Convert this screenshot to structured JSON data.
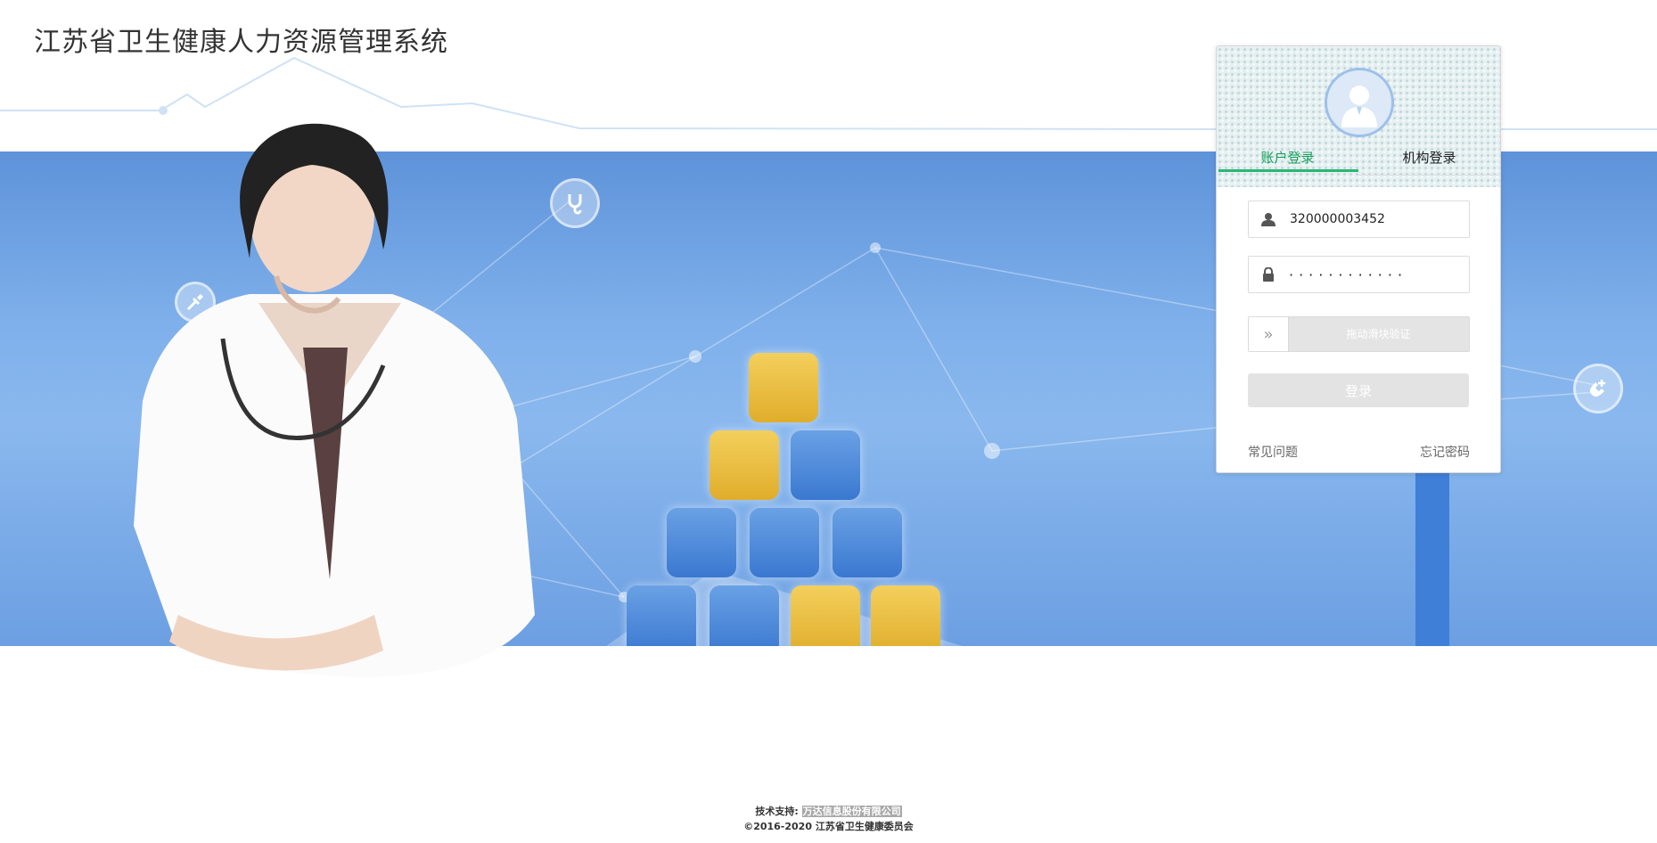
{
  "header": {
    "title": "江苏省卫生健康人力资源管理系统"
  },
  "login": {
    "tabs": [
      {
        "label": "账户登录",
        "active": true
      },
      {
        "label": "机构登录",
        "active": false
      }
    ],
    "username": {
      "value": "320000003452"
    },
    "password": {
      "value": "············"
    },
    "slider": {
      "label": "拖动滑块验证"
    },
    "submit_label": "登录",
    "faq_label": "常见问题",
    "forgot_label": "忘记密码"
  },
  "footer": {
    "support_prefix": "技术支持:",
    "support_company": "万达信息股份有限公司",
    "copyright": "©2016-2020 江苏省卫生健康委员会"
  },
  "colors": {
    "accent": "#2bb673",
    "banner": "#7fb0eb",
    "tile_blue": "#3a78d0",
    "tile_gold": "#e0ad2b"
  },
  "icons": [
    "stethoscope-icon",
    "syringe-icon",
    "pills-icon",
    "heart-pulse-icon",
    "phone-plus-icon",
    "user-icon",
    "lock-icon",
    "double-chevron-right-icon"
  ]
}
